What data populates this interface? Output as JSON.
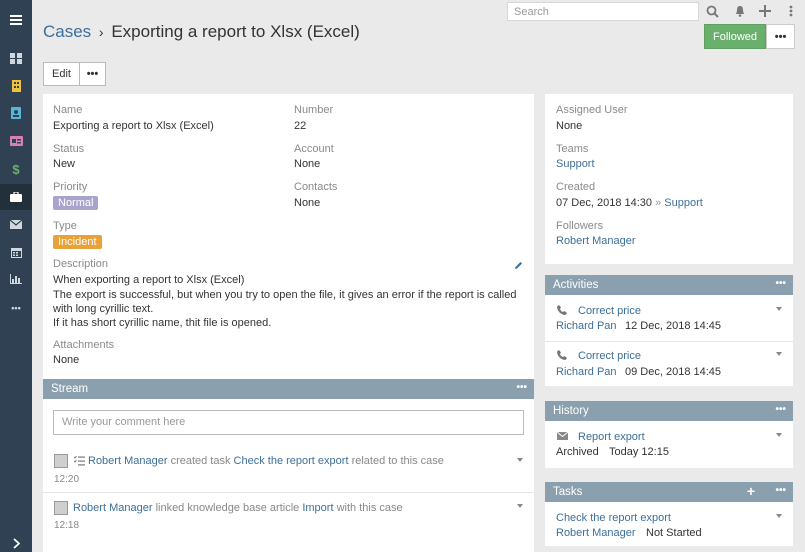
{
  "sidebar": {
    "items": [
      {
        "icon": "menu-icon",
        "color": "#ffffff"
      },
      {
        "icon": "dashboard-icon",
        "color": "#ffffff"
      },
      {
        "icon": "building-icon",
        "color": "#f0c23b"
      },
      {
        "icon": "contact-card-icon",
        "color": "#5bb6d6"
      },
      {
        "icon": "id-card-icon",
        "color": "#d87fba"
      },
      {
        "icon": "dollar-icon",
        "color": "#6ab06d"
      },
      {
        "icon": "briefcase-icon",
        "color": "#ffffff"
      },
      {
        "icon": "envelope-icon",
        "color": "#ffffff"
      },
      {
        "icon": "calendar-icon",
        "color": "#ffffff"
      },
      {
        "icon": "bar-chart-icon",
        "color": "#ffffff"
      },
      {
        "icon": "more-icon",
        "color": "#ffffff"
      },
      {
        "icon": "chevron-right-icon",
        "color": "#ffffff"
      }
    ]
  },
  "topbar": {
    "search_placeholder": "Search"
  },
  "header": {
    "breadcrumb_root": "Cases",
    "breadcrumb_sep": "›",
    "title": "Exporting a report to Xlsx (Excel)",
    "followed_label": "Followed",
    "more_label": "•••",
    "edit_label": "Edit"
  },
  "record": {
    "name_label": "Name",
    "name": "Exporting a report to Xlsx (Excel)",
    "number_label": "Number",
    "number": "22",
    "status_label": "Status",
    "status": "New",
    "account_label": "Account",
    "account": "None",
    "priority_label": "Priority",
    "priority": "Normal",
    "contacts_label": "Contacts",
    "contacts": "None",
    "type_label": "Type",
    "type": "Incident",
    "description_label": "Description",
    "description_lines": [
      "When exporting a report to Xlsx (Excel)",
      "The export is successful, but when you try to open the file, it gives an error if the report is called",
      "with long cyrillic text.",
      "If it has short cyrillic name, thit file is opened."
    ],
    "attachments_label": "Attachments",
    "attachments": "None"
  },
  "colors": {
    "priority_badge": "#a9a4cd",
    "type_badge": "#e8a23a",
    "followed": "#6ab06d",
    "panel_header": "#8aa0ae",
    "link": "#3c6f9a"
  },
  "stream": {
    "title": "Stream",
    "comment_placeholder": "Write your comment here",
    "notes": [
      {
        "user": "Robert Manager",
        "action": "created task",
        "target": "Check the report export",
        "suffix": "related to this case",
        "time": "12:20"
      },
      {
        "user": "Robert Manager",
        "action": "linked knowledge base article",
        "target": "Import",
        "suffix": "with this case",
        "time": "12:18"
      }
    ]
  },
  "side": {
    "assigned_label": "Assigned User",
    "assigned": "None",
    "teams_label": "Teams",
    "teams": "Support",
    "created_label": "Created",
    "created_date": "07 Dec, 2018 14:30",
    "created_sep": "»",
    "created_team": "Support",
    "followers_label": "Followers",
    "followers": "Robert Manager"
  },
  "activities": {
    "title": "Activities",
    "items": [
      {
        "name": "Correct price",
        "user": "Richard Pan",
        "date": "12 Dec, 2018 14:45"
      },
      {
        "name": "Correct price",
        "user": "Richard Pan",
        "date": "09 Dec, 2018 14:45"
      }
    ]
  },
  "history": {
    "title": "History",
    "items": [
      {
        "name": "Report export",
        "status": "Archived",
        "date": "Today 12:15"
      }
    ]
  },
  "tasks": {
    "title": "Tasks",
    "items": [
      {
        "name": "Check the report export",
        "user": "Robert Manager",
        "status": "Not Started"
      }
    ]
  }
}
